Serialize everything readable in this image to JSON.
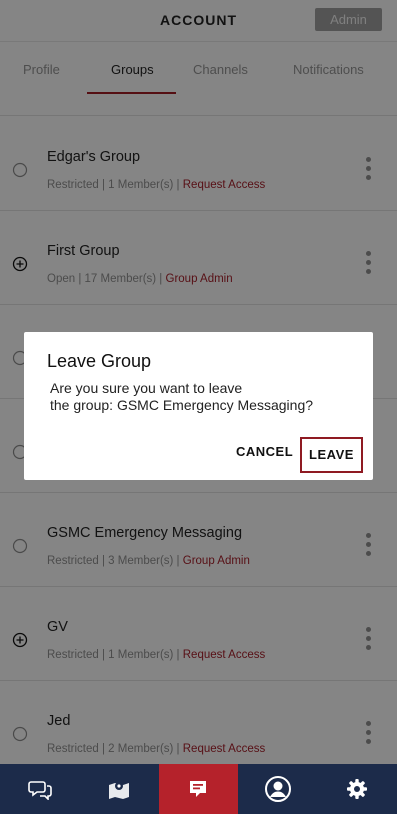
{
  "header": {
    "title": "ACCOUNT",
    "admin_label": "Admin"
  },
  "tabs": [
    {
      "label": "Profile"
    },
    {
      "label": "Groups"
    },
    {
      "label": "Channels"
    },
    {
      "label": "Notifications"
    }
  ],
  "groups": [
    {
      "name": "Edgar's Group",
      "status": "Restricted",
      "members": "1 Member(s)",
      "action": "Request Access",
      "icon": "radio-empty-icon"
    },
    {
      "name": "First Group",
      "status": "Open",
      "members": "17 Member(s)",
      "action": "Group Admin",
      "icon": "plus-circle-icon"
    },
    {
      "name": "",
      "status": "",
      "members": "",
      "action": "",
      "icon": "radio-empty-icon"
    },
    {
      "name": "",
      "status": "",
      "members": "",
      "action": "",
      "icon": "radio-empty-icon"
    },
    {
      "name": "GSMC Emergency Messaging",
      "status": "Restricted",
      "members": "3 Member(s)",
      "action": "Group Admin",
      "icon": "radio-empty-icon"
    },
    {
      "name": "GV",
      "status": "Restricted",
      "members": "1 Member(s)",
      "action": "Request Access",
      "icon": "plus-circle-icon"
    },
    {
      "name": "Jed",
      "status": "Restricted",
      "members": "2 Member(s)",
      "action": "Request Access",
      "icon": "radio-empty-icon"
    }
  ],
  "dialog": {
    "title": "Leave Group",
    "message_line1": "Are you sure you want to leave",
    "message_line2": "the group: GSMC Emergency Messaging?",
    "cancel_label": "CANCEL",
    "leave_label": "LEAVE"
  },
  "bottom_nav": [
    {
      "icon": "chat-bubbles-icon"
    },
    {
      "icon": "map-pin-icon"
    },
    {
      "icon": "message-flag-icon",
      "active": true
    },
    {
      "icon": "user-circle-icon"
    },
    {
      "icon": "gear-icon"
    }
  ],
  "colors": {
    "accent": "#9b1c24",
    "nav_bg": "#1c2b4a",
    "link": "#a0202a"
  }
}
